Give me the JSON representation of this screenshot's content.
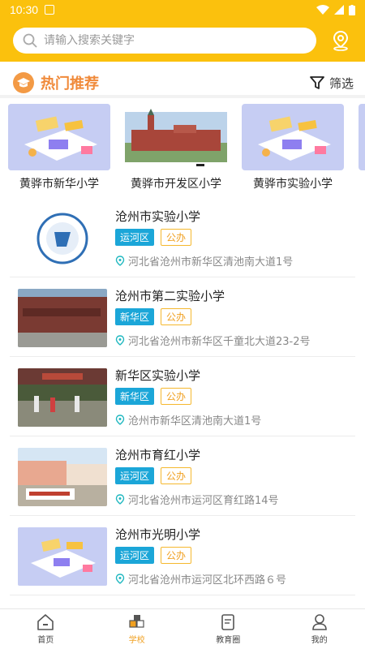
{
  "status": {
    "time": "10:30"
  },
  "search": {
    "placeholder": "请输入搜索关键字"
  },
  "section": {
    "title": "热门推荐",
    "filter_label": "筛选"
  },
  "featured": [
    {
      "name": "黄骅市新华小学"
    },
    {
      "name": "黄骅市开发区小学"
    },
    {
      "name": "黄骅市实验小学"
    }
  ],
  "schools": [
    {
      "name": "沧州市实验小学",
      "district": "运河区",
      "type": "公办",
      "address": "河北省沧州市新华区清池南大道1号"
    },
    {
      "name": "沧州市第二实验小学",
      "district": "新华区",
      "type": "公办",
      "address": "河北省沧州市新华区千童北大道23-2号"
    },
    {
      "name": "新华区实验小学",
      "district": "新华区",
      "type": "公办",
      "address": "沧州市新华区清池南大道1号"
    },
    {
      "name": "沧州市育红小学",
      "district": "运河区",
      "type": "公办",
      "address": "河北省沧州市运河区育红路14号"
    },
    {
      "name": "沧州市光明小学",
      "district": "运河区",
      "type": "公办",
      "address": "河北省沧州市运河区北环西路６号"
    }
  ],
  "tabs": [
    {
      "label": "首页",
      "icon": "home-icon"
    },
    {
      "label": "学校",
      "icon": "school-icon",
      "active": true
    },
    {
      "label": "教育圈",
      "icon": "edu-circle-icon"
    },
    {
      "label": "我的",
      "icon": "profile-icon"
    }
  ],
  "colors": {
    "brand": "#fbc10d",
    "accent": "#f08a3a",
    "district_tag": "#1ba6d8",
    "type_tag": "#f5b82e"
  }
}
